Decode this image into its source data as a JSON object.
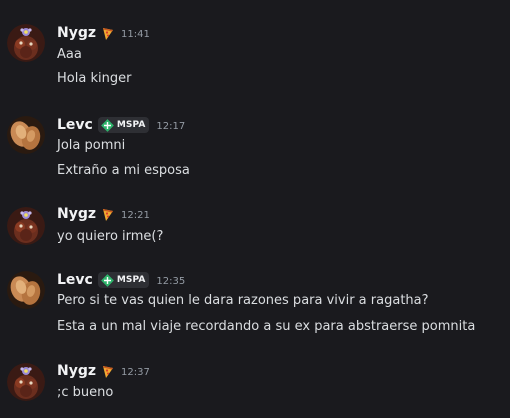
{
  "messages": [
    {
      "author": "Nygz",
      "author_tag_icon": "pizza-icon",
      "timestamp": "11:41",
      "lines": [
        "Aaa",
        "Hola kinger"
      ]
    },
    {
      "author": "Levc",
      "clan_tag": "MSPA",
      "clan_tag_icon": "green-diamond-badge-icon",
      "timestamp": "12:17",
      "lines": [
        "Jola pomni",
        "Extraño a mi esposa"
      ]
    },
    {
      "author": "Nygz",
      "author_tag_icon": "pizza-icon",
      "timestamp": "12:21",
      "lines": [
        "yo quiero irme(?"
      ]
    },
    {
      "author": "Levc",
      "clan_tag": "MSPA",
      "clan_tag_icon": "green-diamond-badge-icon",
      "timestamp": "12:35",
      "lines": [
        "Pero si te vas quien le dara razones para vivir a ragatha?",
        "Esta a un mal viaje recordando a su ex para abstraerse pomnita"
      ]
    },
    {
      "author": "Nygz",
      "author_tag_icon": "pizza-icon",
      "timestamp": "12:37",
      "lines": [
        ";c bueno"
      ]
    }
  ],
  "colors": {
    "background": "#1a1a1e",
    "username": "#f2f3f5",
    "message_text": "#dbdee1",
    "timestamp": "#949ba4",
    "clan_tag_bg": "#2e2f34",
    "clan_badge_green": "#2fb36b"
  }
}
